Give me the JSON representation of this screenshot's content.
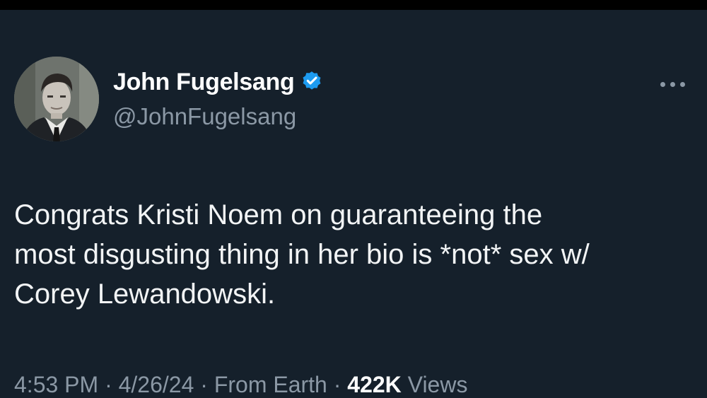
{
  "tweet": {
    "author": {
      "display_name": "John Fugelsang",
      "handle": "@JohnFugelsang",
      "verified_icon": "verified-badge-icon",
      "verified_color": "#1d9bf0"
    },
    "more_icon": "more-horizontal-icon",
    "text_lines": [
      "Congrats Kristi Noem on guaranteeing the",
      "most disgusting thing in her bio is *not* sex w/",
      "Corey Lewandowski."
    ],
    "meta": {
      "time": "4:53 PM",
      "date": "4/26/24",
      "source": "From Earth",
      "views_count": "422K",
      "views_label": "Views"
    }
  },
  "colors": {
    "background": "#15202b",
    "text": "#ffffff",
    "secondary": "#8b98a5",
    "accent": "#1d9bf0"
  }
}
